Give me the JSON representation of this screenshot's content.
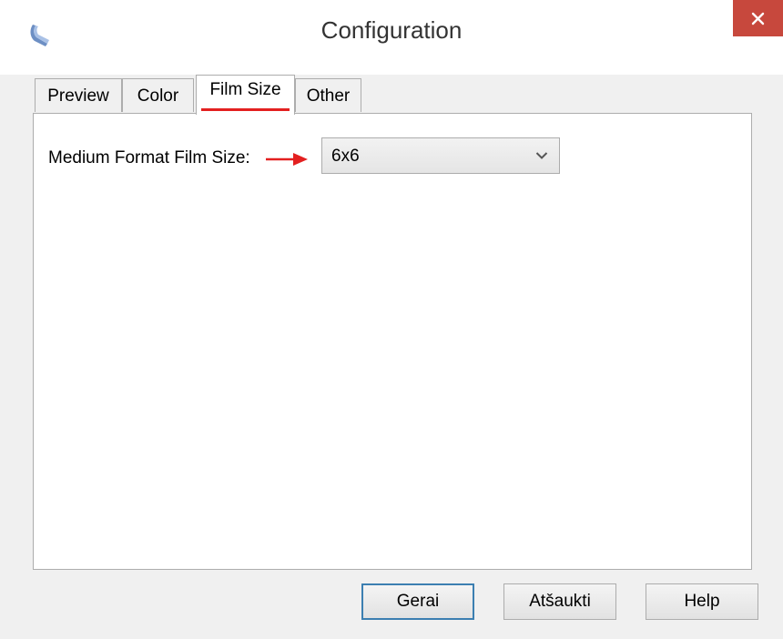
{
  "window": {
    "title": "Configuration",
    "accent_color": "#c7483d"
  },
  "tabs": [
    {
      "label": "Preview",
      "active": false
    },
    {
      "label": "Color",
      "active": false
    },
    {
      "label": "Film Size",
      "active": true
    },
    {
      "label": "Other",
      "active": false
    }
  ],
  "film_size": {
    "label": "Medium Format Film Size:",
    "selected_value": "6x6",
    "annotation_color": "#e32020"
  },
  "buttons": {
    "ok_label": "Gerai",
    "cancel_label": "Atšaukti",
    "help_label": "Help"
  },
  "icons": {
    "app": "scanner-app-icon",
    "close": "close-icon",
    "dropdown": "chevron-down-icon",
    "annotation": "arrow-right-icon"
  }
}
